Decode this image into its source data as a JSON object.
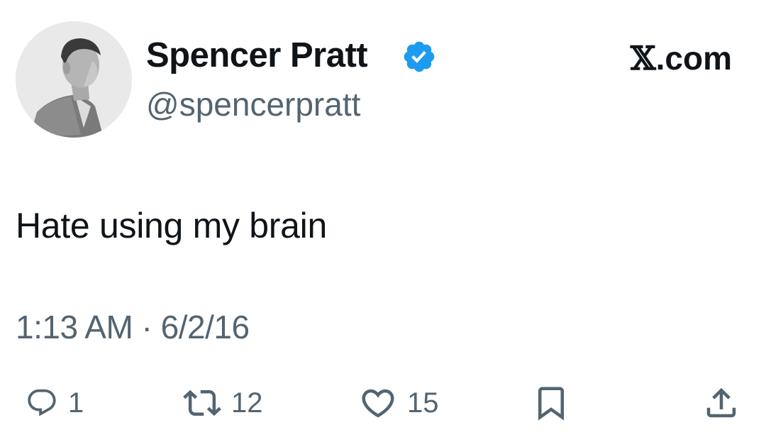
{
  "user": {
    "display_name": "Spencer Pratt",
    "handle": "@spencerpratt",
    "verified": true,
    "avatar": "profile-photo"
  },
  "brand": {
    "label": ".com",
    "icon": "x-logo-icon"
  },
  "tweet": {
    "text": "Hate using my brain",
    "timestamp": "1:13 AM · 6/2/16"
  },
  "actions": {
    "reply": {
      "icon": "reply-icon",
      "count": "1"
    },
    "retweet": {
      "icon": "retweet-icon",
      "count": "12"
    },
    "like": {
      "icon": "heart-icon",
      "count": "15"
    },
    "bookmark": {
      "icon": "bookmark-icon"
    },
    "share": {
      "icon": "share-icon"
    }
  },
  "colors": {
    "text": "#0f1419",
    "secondary": "#536471",
    "verified": "#1d9bf0"
  }
}
